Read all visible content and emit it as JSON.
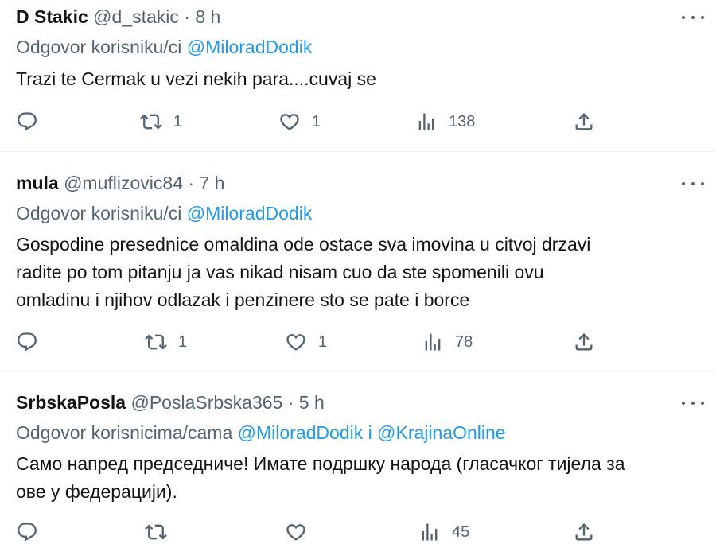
{
  "tweets": [
    {
      "name": "D Stakic",
      "handle": "@d_stakic",
      "separator": "·",
      "time": "8 h",
      "reply_prefix": "Odgovor korisniku/ci",
      "mention1": "@MiloradDodik",
      "joiner": "",
      "mention2": "",
      "lines": [
        "Trazi te Cermak u vezi nekih para....cuvaj se"
      ],
      "replies": "",
      "retweets": "1",
      "likes": "1",
      "views": "138"
    },
    {
      "name": "mula",
      "handle": "@muflizovic84",
      "separator": "·",
      "time": "7 h",
      "reply_prefix": "Odgovor korisniku/ci",
      "mention1": "@MiloradDodik",
      "joiner": "",
      "mention2": "",
      "lines": [
        "Gospodine presednice omaldina ode ostace sva imovina u citvoj drzavi",
        "radite po tom pitanju ja vas nikad nisam cuo da ste spomenili  ovu",
        "omladinu i njihov odlazak i penzinere sto se pate i borce"
      ],
      "replies": "",
      "retweets": "1",
      "likes": "1",
      "views": "78"
    },
    {
      "name": "SrbskaPosla",
      "handle": "@PoslaSrbska365",
      "separator": "·",
      "time": "5 h",
      "reply_prefix": "Odgovor korisnicima/cama",
      "mention1": "@MiloradDodik",
      "joiner": "i",
      "mention2": "@KrajinaOnline",
      "lines": [
        "Само напред председниче! Имате подршку народа (гласачког тијела за",
        "ове у федерацији)."
      ],
      "replies": "",
      "retweets": "",
      "likes": "",
      "views": "45"
    }
  ],
  "icons": {
    "reply": "reply-icon",
    "retweet": "retweet-icon",
    "like": "like-icon",
    "views": "views-icon",
    "share": "share-icon",
    "more": "more-icon"
  },
  "colors": {
    "text": "#0f1419",
    "secondary": "#536471",
    "link": "#1d9bf0",
    "divider": "#eff3f4"
  }
}
